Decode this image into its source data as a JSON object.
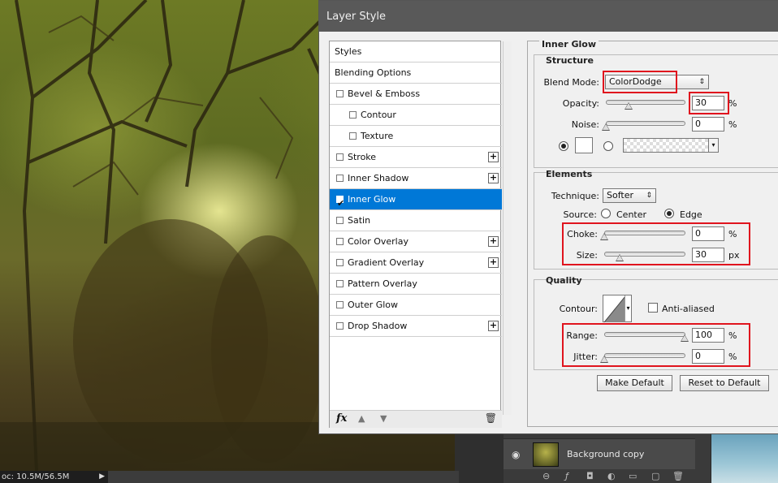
{
  "status_bar": {
    "doc_text": "oc: 10.5M/56.5M"
  },
  "layers_panel": {
    "layer_name": "Background copy"
  },
  "dialog": {
    "title": "Layer Style",
    "styles_list": [
      {
        "label": "Styles",
        "checkbox": false,
        "checked": false,
        "plus": false,
        "indent": 0
      },
      {
        "label": "Blending Options",
        "checkbox": false,
        "checked": false,
        "plus": false,
        "indent": 0
      },
      {
        "label": "Bevel & Emboss",
        "checkbox": true,
        "checked": false,
        "plus": false,
        "indent": 0
      },
      {
        "label": "Contour",
        "checkbox": true,
        "checked": false,
        "plus": false,
        "indent": 1
      },
      {
        "label": "Texture",
        "checkbox": true,
        "checked": false,
        "plus": false,
        "indent": 1
      },
      {
        "label": "Stroke",
        "checkbox": true,
        "checked": false,
        "plus": true,
        "indent": 0
      },
      {
        "label": "Inner Shadow",
        "checkbox": true,
        "checked": false,
        "plus": true,
        "indent": 0
      },
      {
        "label": "Inner Glow",
        "checkbox": true,
        "checked": true,
        "plus": false,
        "indent": 0,
        "selected": true
      },
      {
        "label": "Satin",
        "checkbox": true,
        "checked": false,
        "plus": false,
        "indent": 0
      },
      {
        "label": "Color Overlay",
        "checkbox": true,
        "checked": false,
        "plus": true,
        "indent": 0
      },
      {
        "label": "Gradient Overlay",
        "checkbox": true,
        "checked": false,
        "plus": true,
        "indent": 0
      },
      {
        "label": "Pattern Overlay",
        "checkbox": true,
        "checked": false,
        "plus": false,
        "indent": 0
      },
      {
        "label": "Outer Glow",
        "checkbox": true,
        "checked": false,
        "plus": false,
        "indent": 0
      },
      {
        "label": "Drop Shadow",
        "checkbox": true,
        "checked": false,
        "plus": true,
        "indent": 0
      }
    ],
    "footer": {
      "fx_label": "fx"
    },
    "panel": {
      "title": "Inner Glow",
      "structure": {
        "heading": "Structure",
        "blend_mode_label": "Blend Mode:",
        "blend_mode_value": "ColorDodge",
        "opacity_label": "Opacity:",
        "opacity_value": "30",
        "opacity_unit": "%",
        "noise_label": "Noise:",
        "noise_value": "0",
        "noise_unit": "%"
      },
      "elements": {
        "heading": "Elements",
        "technique_label": "Technique:",
        "technique_value": "Softer",
        "source_label": "Source:",
        "source_center": "Center",
        "source_edge": "Edge",
        "choke_label": "Choke:",
        "choke_value": "0",
        "choke_unit": "%",
        "size_label": "Size:",
        "size_value": "30",
        "size_unit": "px"
      },
      "quality": {
        "heading": "Quality",
        "contour_label": "Contour:",
        "anti_aliased_label": "Anti-aliased",
        "range_label": "Range:",
        "range_value": "100",
        "range_unit": "%",
        "jitter_label": "Jitter:",
        "jitter_value": "0",
        "jitter_unit": "%"
      },
      "buttons": {
        "make_default": "Make Default",
        "reset_to_default": "Reset to Default"
      }
    }
  },
  "colors": {
    "selection_blue": "#0078d7",
    "highlight_red": "#e0141e",
    "titlebar": "#595959"
  }
}
